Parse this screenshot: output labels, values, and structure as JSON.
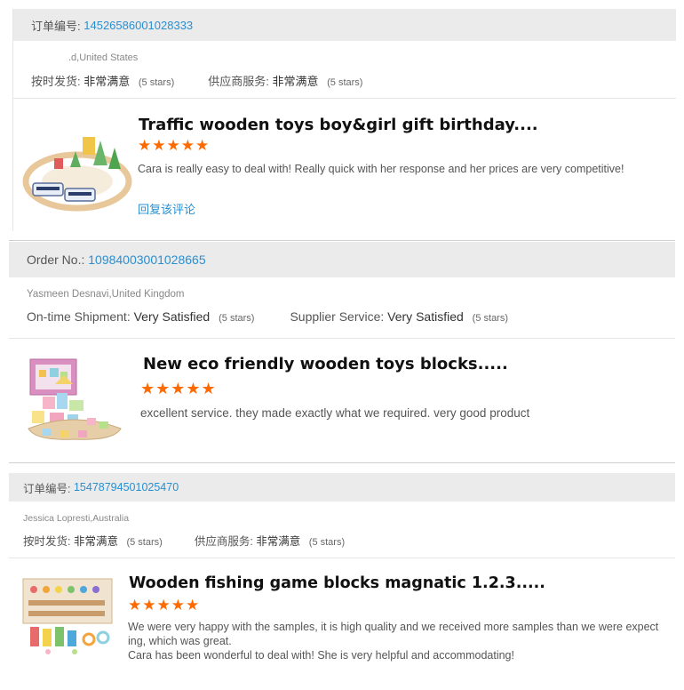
{
  "reviews": [
    {
      "order_label": "订单编号:",
      "order_number": "14526586001028333",
      "buyer": ".d,United States",
      "shipment_label": "按时发货:",
      "shipment_value": "非常满意",
      "shipment_stars": "(5 stars)",
      "service_label": "供应商服务:",
      "service_value": "非常满意",
      "service_stars": "(5 stars)",
      "product_title": "Traffic wooden toys boy&girl  gift birthday....",
      "rating": 5,
      "stars": "★★★★★",
      "comment": "Cara is really easy to deal with! Really quick with her response and her prices are very competitive!",
      "reply_link": "回复该评论",
      "thumb_icon": "train-set-toy-icon"
    },
    {
      "order_label": "Order No.:",
      "order_number": "10984003001028665",
      "buyer": "Yasmeen Desnavi,United Kingdom",
      "shipment_label": "On-time Shipment:",
      "shipment_value": "Very Satisfied",
      "shipment_stars": "(5 stars)",
      "service_label": "Supplier Service:",
      "service_value": "Very Satisfied",
      "service_stars": "(5 stars)",
      "product_title": "New eco friendly wooden toys blocks.....",
      "rating": 5,
      "stars": "★★★★★",
      "comment": "excellent service. they made exactly what we required. very good product",
      "thumb_icon": "building-blocks-toy-icon"
    },
    {
      "order_label": "订单编号:",
      "order_number": "15478794501025470",
      "buyer": "Jessica Lopresti,Australia",
      "shipment_label": "按时发货:",
      "shipment_value": "非常满意",
      "shipment_stars": "(5 stars)",
      "service_label": "供应商服务:",
      "service_value": "非常满意",
      "service_stars": "(5 stars)",
      "product_title": "Wooden fishing game blocks magnatic 1.2.3.....",
      "rating": 5,
      "stars": "★★★★★",
      "comment_line1": "We were very happy with the samples, it is high quality and we received more samples than we were expect",
      "comment_line2": "ing, which was great.",
      "comment_line3": "Cara has been wonderful to deal with! She is very helpful and accommodating!",
      "thumb_icon": "fishing-game-toy-icon"
    }
  ],
  "colors": {
    "link": "#2a8fd0",
    "star": "#ff6a00",
    "bar": "#ebebeb"
  }
}
